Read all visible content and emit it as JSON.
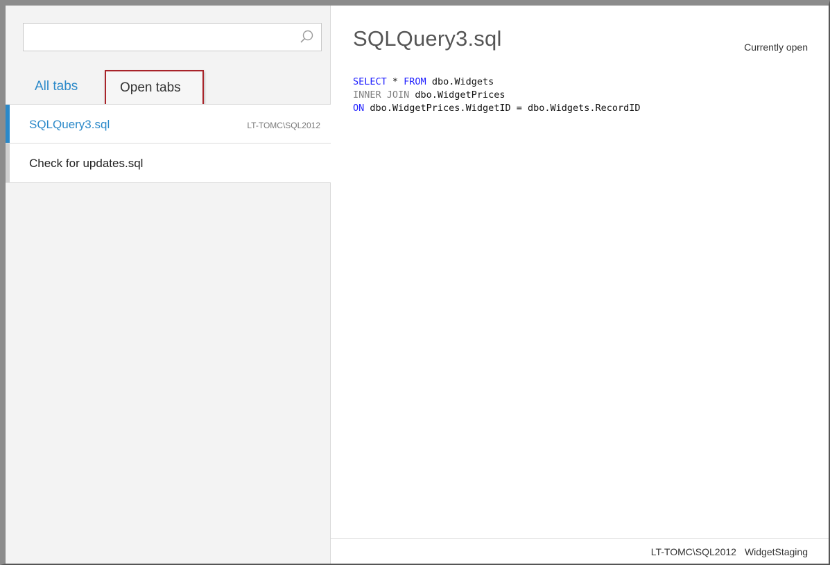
{
  "search": {
    "value": "",
    "placeholder": "",
    "icon": "search-icon"
  },
  "tabs": {
    "all_label": "All tabs",
    "open_label": "Open tabs",
    "highlight_color": "#a8242a"
  },
  "files": [
    {
      "name": "SQLQuery3.sql",
      "server": "LT-TOMC\\SQL2012",
      "active": true
    },
    {
      "name": "Check for updates.sql",
      "server": "",
      "active": false
    }
  ],
  "document": {
    "title": "SQLQuery3.sql",
    "status": "Currently open",
    "code": {
      "line1_kw1": "SELECT",
      "line1_mid": " * ",
      "line1_kw2": "FROM",
      "line1_rest": " dbo.Widgets",
      "line2_kw": "INNER JOIN",
      "line2_rest": " dbo.WidgetPrices",
      "line3_kw": "ON",
      "line3_rest": " dbo.WidgetPrices.WidgetID = dbo.Widgets.RecordID"
    }
  },
  "footer": {
    "server": "LT-TOMC\\SQL2012",
    "database": "WidgetStaging"
  },
  "colors": {
    "accent": "#2b89c9",
    "keyword_blue": "#1f1fff",
    "keyword_gray": "#808080"
  }
}
